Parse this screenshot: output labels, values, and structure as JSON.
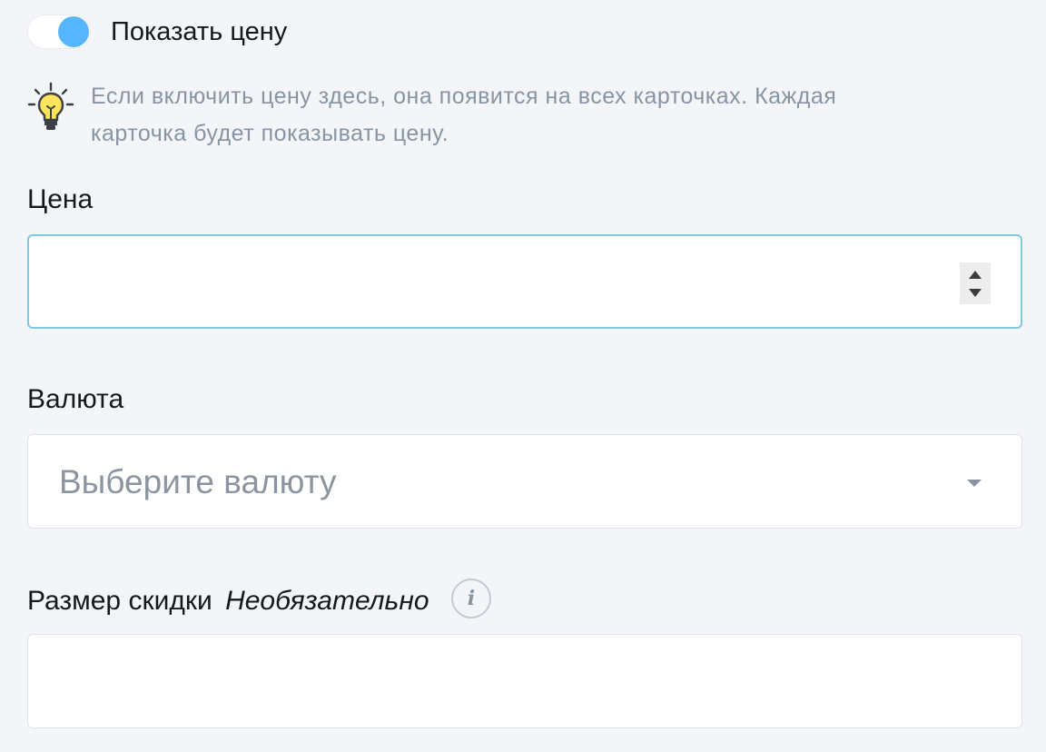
{
  "show_price": {
    "label": "Показать цену",
    "enabled": true,
    "accent_color": "#55b5ff"
  },
  "hint": {
    "icon": "lightbulb-icon",
    "text": "Если включить цену здесь, она появится на всех карточках. Каждая карточка будет показывать цену."
  },
  "price": {
    "label": "Цена",
    "value": ""
  },
  "currency": {
    "label": "Валюта",
    "placeholder": "Выберите валюту"
  },
  "discount": {
    "label": "Размер скидки",
    "optional_label": "Необязательно",
    "info_icon": "i",
    "value": ""
  }
}
